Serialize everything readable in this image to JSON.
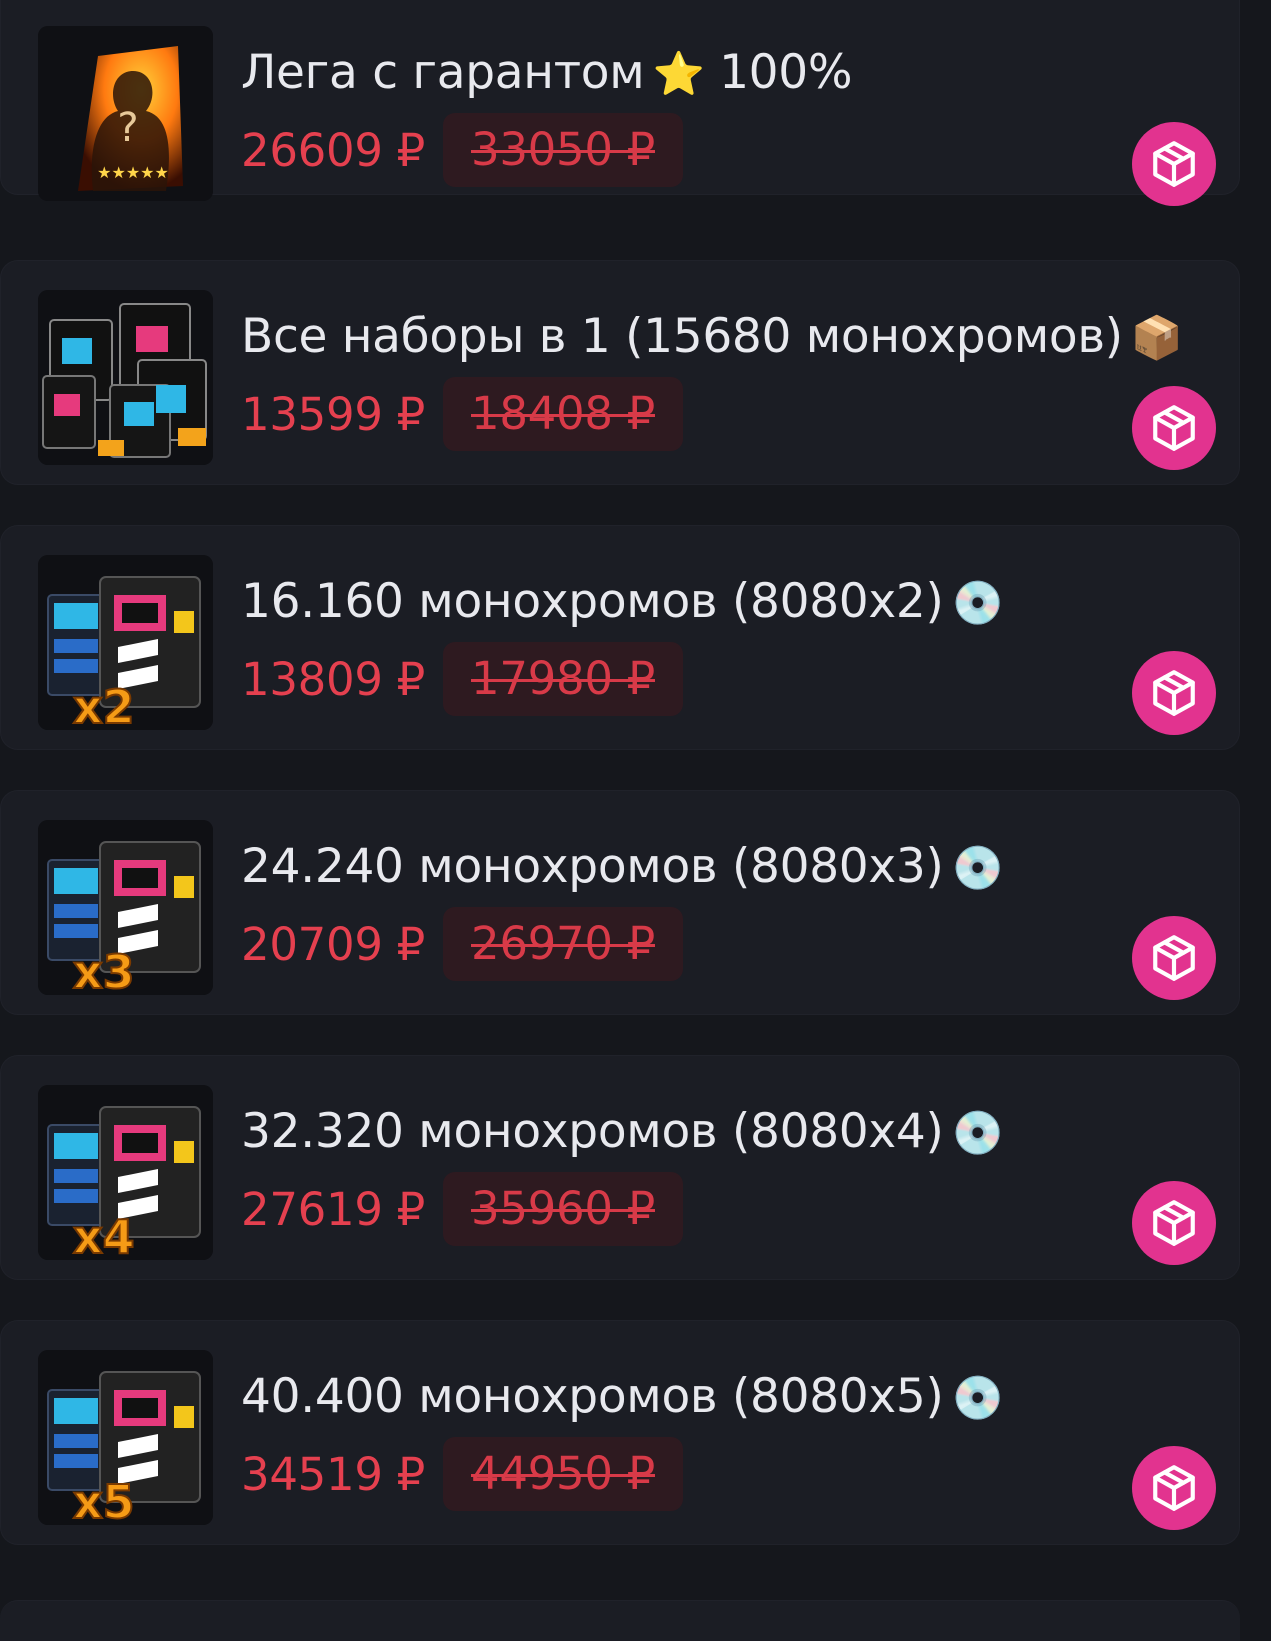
{
  "products": [
    {
      "title": "Лега с гарантом",
      "emoji": "⭐",
      "title_suffix": "100%",
      "price": "26609 ₽",
      "old_price": "33050 ₽",
      "image": "legendary-mystery-card-image"
    },
    {
      "title": "Все наборы в 1 (15680 монохромов)",
      "emoji": "📦",
      "title_suffix": "",
      "price": "13599 ₽",
      "old_price": "18408 ₽",
      "image": "all-packs-bundle-image"
    },
    {
      "title": "16.160 монохромов (8080x2)",
      "emoji": "💿",
      "title_suffix": "",
      "price": "13809 ₽",
      "old_price": "17980 ₽",
      "image": "monochrome-box-x2-image",
      "multiplier": "x2"
    },
    {
      "title": "24.240 монохромов (8080x3)",
      "emoji": "💿",
      "title_suffix": "",
      "price": "20709 ₽",
      "old_price": "26970 ₽",
      "image": "monochrome-box-x3-image",
      "multiplier": "x3"
    },
    {
      "title": "32.320 монохромов (8080x4)",
      "emoji": "💿",
      "title_suffix": "",
      "price": "27619 ₽",
      "old_price": "35960 ₽",
      "image": "monochrome-box-x4-image",
      "multiplier": "x4"
    },
    {
      "title": "40.400 монохромов (8080x5)",
      "emoji": "💿",
      "title_suffix": "",
      "price": "34519 ₽",
      "old_price": "44950 ₽",
      "image": "monochrome-box-x5-image",
      "multiplier": "x5"
    }
  ],
  "cart_button_icon": "package-cube-icon",
  "colors": {
    "background": "#15171c",
    "card": "#1b1d24",
    "title": "#e8e9ee",
    "price": "#e5404f",
    "old_price_bg": "#2e1a20",
    "accent_button": "#e2338f"
  }
}
